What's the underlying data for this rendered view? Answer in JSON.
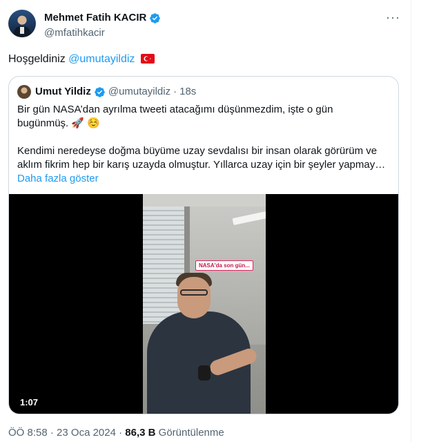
{
  "author": {
    "display_name": "Mehmet Fatih KACIR",
    "handle": "@mfatihkacir"
  },
  "more_icon": "more-horizontal-icon",
  "tweet": {
    "text_prefix": "Hoşgeldiniz ",
    "mention": "@umutayildiz"
  },
  "quote": {
    "display_name": "Umut Yildiz",
    "handle": "@umutayildiz",
    "separator": "·",
    "time": "18s",
    "line1": "Bir gün NASA’dan ayrılma tweeti atacağımı düşünmezdim, işte o gün",
    "line2": "bugünmüş. 🚀 ☺️",
    "line3": "Kendimi neredeyse doğma büyüme uzay sevdalısı bir insan olarak görürüm ve",
    "line4": "aklım fikrim hep bir karış uzayda olmuştur. Yıllarca uzay için bir şeyler yapmay…",
    "show_more": "Daha fazla göster",
    "video": {
      "caption": "NASA'da son gün...",
      "duration": "1:07"
    }
  },
  "meta": {
    "time": "ÖÖ 8:58",
    "sep1": " · ",
    "date": "23 Oca 2024",
    "sep2": " · ",
    "views_count": "86,3 B",
    "views_label": " Görüntülenme"
  },
  "colors": {
    "link": "#1d9bf0",
    "muted": "#536471",
    "verified": "#1d9bf0",
    "border": "#cfd9de"
  }
}
